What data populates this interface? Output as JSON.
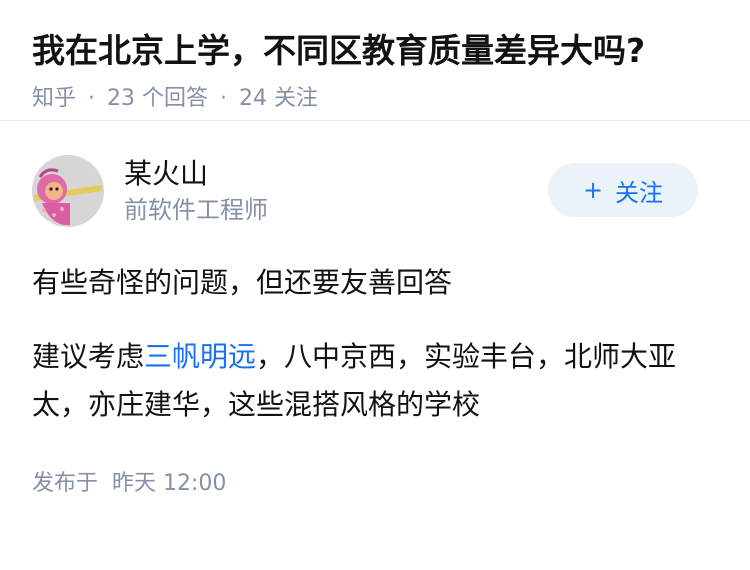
{
  "question": {
    "title": "我在北京上学，不同区教育质量差异大吗?",
    "source": "知乎",
    "answers_count": "23",
    "answers_label": "个回答",
    "followers_count": "24",
    "followers_label": "关注"
  },
  "author": {
    "name": "某火山",
    "bio": "前软件工程师",
    "follow_label": "关注",
    "follow_icon": "plus-icon"
  },
  "answer": {
    "paragraph1": "有些奇怪的问题，但还要友善回答",
    "paragraph2_prefix": "建议考虑",
    "paragraph2_link": "三帆明远",
    "paragraph2_suffix": "，八中京西，实验丰台，北师大亚太，亦庄建华，这些混搭风格的学校",
    "publish_label": "发布于",
    "publish_time": "昨天 12:00"
  },
  "colors": {
    "text": "#121212",
    "meta": "#8590a6",
    "link": "#1772f6",
    "follow_bg": "#eaf2fa"
  }
}
